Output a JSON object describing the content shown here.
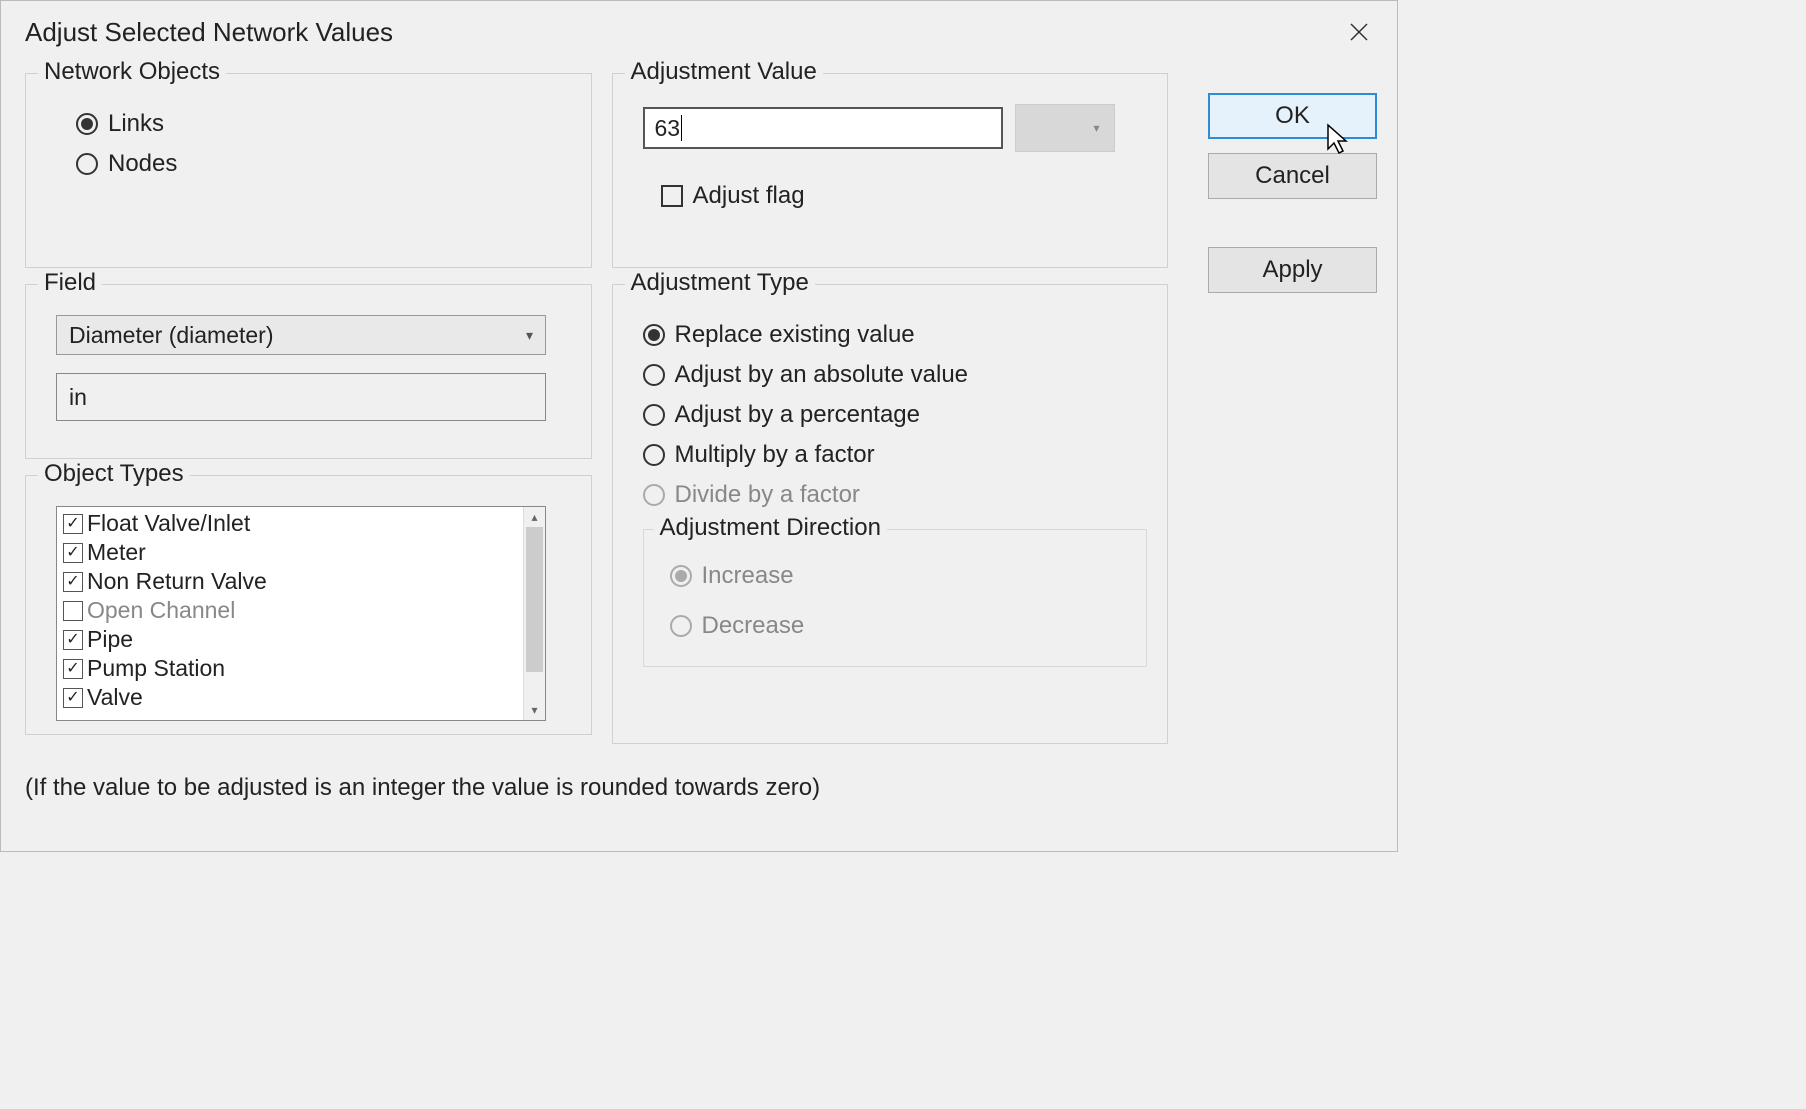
{
  "dialog": {
    "title": "Adjust Selected Network Values",
    "footnote": "(If the value to be adjusted  is an integer the value is rounded towards zero)"
  },
  "buttons": {
    "ok": "OK",
    "cancel": "Cancel",
    "apply": "Apply"
  },
  "networkObjects": {
    "groupTitle": "Network Objects",
    "links": "Links",
    "nodes": "Nodes"
  },
  "field": {
    "groupTitle": "Field",
    "selected": "Diameter (diameter)",
    "unit": "in"
  },
  "objectTypes": {
    "groupTitle": "Object Types",
    "items": [
      {
        "label": "Float Valve/Inlet",
        "checked": true,
        "enabled": true
      },
      {
        "label": "Meter",
        "checked": true,
        "enabled": true
      },
      {
        "label": "Non Return Valve",
        "checked": true,
        "enabled": true
      },
      {
        "label": "Open Channel",
        "checked": false,
        "enabled": false
      },
      {
        "label": "Pipe",
        "checked": true,
        "enabled": true
      },
      {
        "label": "Pump Station",
        "checked": true,
        "enabled": true
      },
      {
        "label": "Valve",
        "checked": true,
        "enabled": true
      }
    ]
  },
  "adjustmentValue": {
    "groupTitle": "Adjustment Value",
    "value": "63",
    "adjustFlag": "Adjust flag"
  },
  "adjustmentType": {
    "groupTitle": "Adjustment Type",
    "replace": "Replace existing value",
    "absolute": "Adjust by an absolute value",
    "percentage": "Adjust by a percentage",
    "multiply": "Multiply by a factor",
    "divide": "Divide by a factor"
  },
  "adjustmentDirection": {
    "groupTitle": "Adjustment Direction",
    "increase": "Increase",
    "decrease": "Decrease"
  }
}
